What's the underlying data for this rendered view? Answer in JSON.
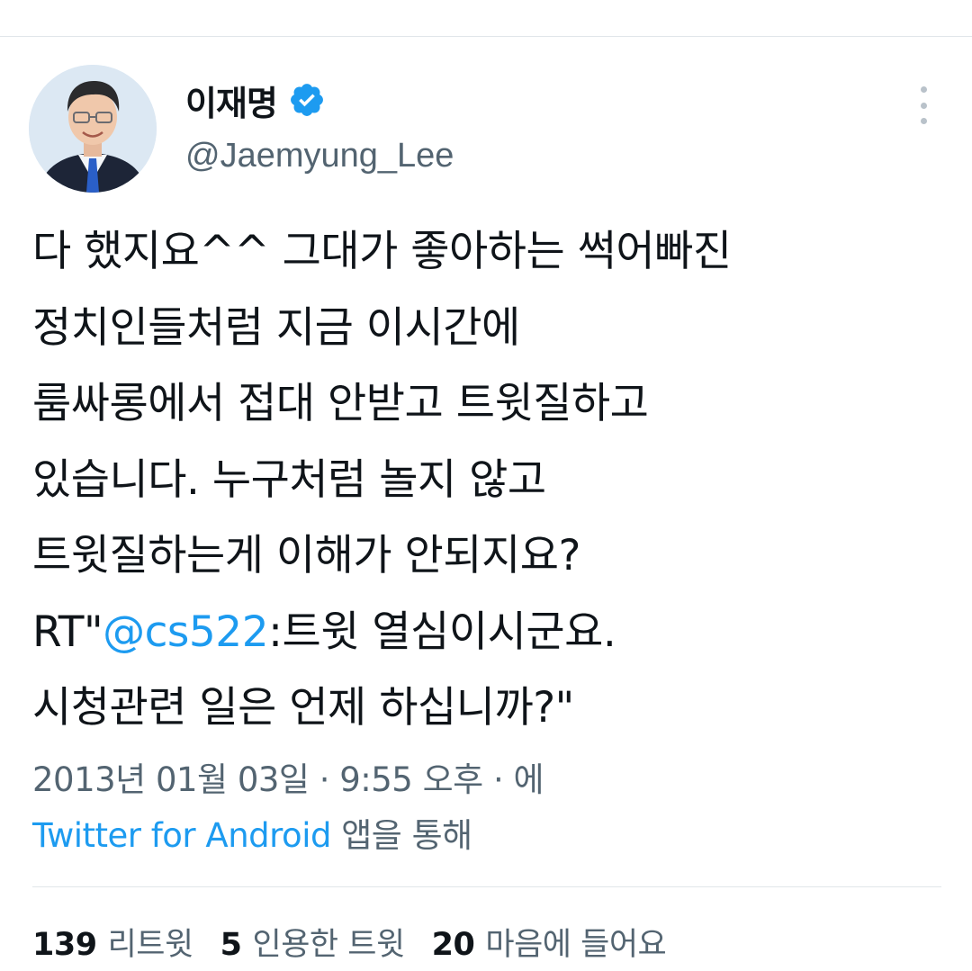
{
  "user": {
    "display_name": "이재명",
    "handle": "@Jaemyung_Lee",
    "verified": true
  },
  "tweet": {
    "lines": [
      "다 했지요^^ 그대가 좋아하는 썩어빠진",
      "정치인들처럼 지금 이시간에",
      "룸싸롱에서 접대 안받고 트윗질하고",
      "있습니다. 누구처럼 놀지 않고",
      "트윗질하는게 이해가 안되지요?"
    ],
    "rt_prefix": "RT\"",
    "mention": "@cs522",
    "rt_rest": ":트윗 열심이시군요.",
    "last_line": "시청관련 일은 언제 하십니까?\""
  },
  "meta": {
    "timestamp": "2013년 01월 03일 · 9:55 오후 · 에",
    "source": "Twitter for Android",
    "source_suffix": " 앱을 통해"
  },
  "stats": {
    "retweets_count": "139",
    "retweets_label": "리트윗",
    "quotes_count": "5",
    "quotes_label": "인용한 트윗",
    "likes_count": "20",
    "likes_label": "마음에 들어요"
  },
  "colors": {
    "accent": "#1d9bf0",
    "secondary_text": "#536471",
    "divider": "#e1e6ea"
  },
  "icons": {
    "verified": "verified-badge-icon",
    "more": "more-options-icon"
  }
}
